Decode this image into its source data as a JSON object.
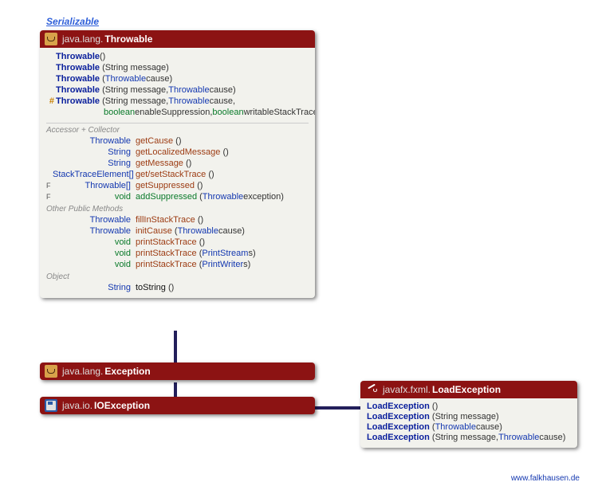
{
  "serializable": "Serializable",
  "footer": "www.falkhausen.de",
  "throwable": {
    "pkg": "java.lang.",
    "cls": "Throwable",
    "ctors": [
      {
        "mod": "",
        "name": "Throwable",
        "params": "()"
      },
      {
        "mod": "",
        "name": "Throwable",
        "params": "(String message)"
      },
      {
        "mod": "",
        "name": "Throwable",
        "params_pre": "(",
        "type1": "Throwable",
        "params_post": " cause)"
      },
      {
        "mod": "",
        "name": "Throwable",
        "params_pre": "(String message, ",
        "type1": "Throwable",
        "params_post": " cause)"
      },
      {
        "mod": "#",
        "name": "Throwable",
        "params_pre": "(String message, ",
        "type1": "Throwable",
        "params_post": " cause,"
      }
    ],
    "ctor_cont": {
      "kw1": "boolean",
      "t1": " enableSuppression, ",
      "kw2": "boolean",
      "t2": " writableStackTrace)"
    },
    "sec1": "Accessor + Collector",
    "accessors": [
      {
        "F": "",
        "ret": "Throwable",
        "name": "getCause",
        "params": "()"
      },
      {
        "F": "",
        "ret": "String",
        "name": "getLocalizedMessage",
        "params": "()"
      },
      {
        "F": "",
        "ret": "String",
        "name": "getMessage",
        "params": "()"
      },
      {
        "F": "",
        "ret": "StackTraceElement[]",
        "name": "get/setStackTrace",
        "params": "()"
      },
      {
        "F": "F",
        "ret": "Throwable[]",
        "name": "getSuppressed",
        "params": "()"
      },
      {
        "F": "F",
        "ret": "void",
        "ret_green": true,
        "name": "addSuppressed",
        "name_green": true,
        "params_pre": "(",
        "type1": "Throwable",
        "params_post": " exception)"
      }
    ],
    "sec2": "Other Public Methods",
    "others": [
      {
        "ret": "Throwable",
        "name": "fillInStackTrace",
        "params": "()"
      },
      {
        "ret": "Throwable",
        "name": "initCause",
        "params_pre": "(",
        "type1": "Throwable",
        "params_post": " cause)"
      },
      {
        "ret": "void",
        "ret_green": true,
        "name": "printStackTrace",
        "params": "()"
      },
      {
        "ret": "void",
        "ret_green": true,
        "name": "printStackTrace",
        "params_pre": "(",
        "type1": "PrintStream",
        "params_post": " s)"
      },
      {
        "ret": "void",
        "ret_green": true,
        "name": "printStackTrace",
        "params_pre": "(",
        "type1": "PrintWriter",
        "params_post": " s)"
      }
    ],
    "sec3": "Object",
    "obj": {
      "ret": "String",
      "name": "toString",
      "params": "()"
    }
  },
  "exception": {
    "pkg": "java.lang.",
    "cls": "Exception"
  },
  "ioexception": {
    "pkg": "java.io.",
    "cls": "IOException"
  },
  "loadexception": {
    "pkg": "javafx.fxml.",
    "cls": "LoadException",
    "ctors": [
      {
        "name": "LoadException",
        "params": "()"
      },
      {
        "name": "LoadException",
        "params": "(String message)"
      },
      {
        "name": "LoadException",
        "params_pre": "(",
        "type1": "Throwable",
        "params_post": " cause)"
      },
      {
        "name": "LoadException",
        "params_pre": "(String message, ",
        "type1": "Throwable",
        "params_post": " cause)"
      }
    ]
  }
}
